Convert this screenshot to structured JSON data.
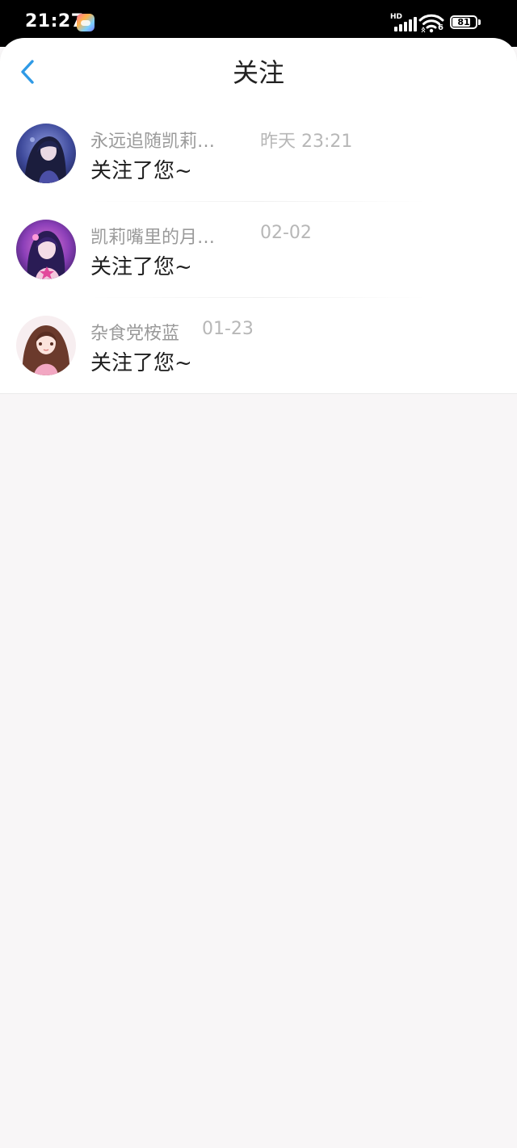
{
  "status_bar": {
    "time": "21:27",
    "network_label": "HD",
    "wifi_label": "6",
    "battery_level": "81"
  },
  "header": {
    "title": "关注"
  },
  "notifications": [
    {
      "name": "永远追随凯莉…",
      "time": "昨天 23:21",
      "message": "关注了您~"
    },
    {
      "name": "凯莉嘴里的月…",
      "time": "02-02",
      "message": "关注了您~"
    },
    {
      "name": "杂食党桉蓝",
      "time": "01-23",
      "message": "关注了您~"
    }
  ]
}
